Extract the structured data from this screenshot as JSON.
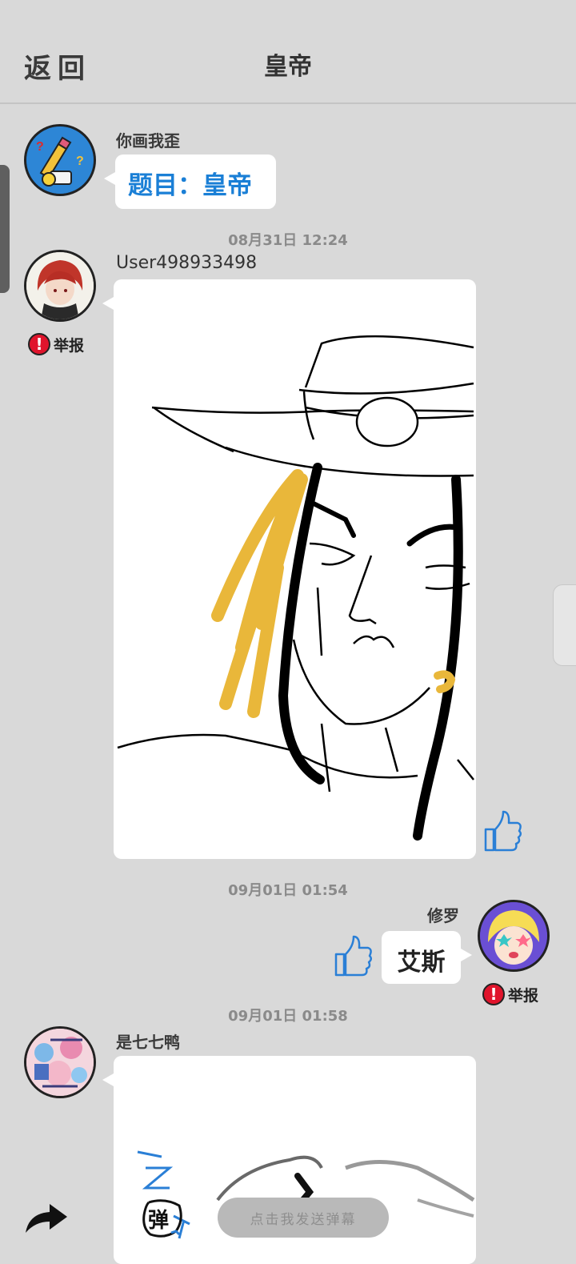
{
  "header": {
    "back_label": "返回",
    "title": "皇帝"
  },
  "messages": [
    {
      "name": "你画我歪",
      "text": "题目：皇帝"
    },
    {
      "time": "08月31日  12:24",
      "name": "User498933498",
      "report": "举报"
    },
    {
      "time": "09月01日  01:54",
      "name": "修罗",
      "text": "艾斯",
      "report": "举报"
    },
    {
      "time": "09月01日  01:58",
      "name": "是七七鸭"
    }
  ],
  "bottom": {
    "danmu_placeholder": "点击我发送弹幕",
    "danmu_icon_char": "弹"
  },
  "colors": {
    "topic_blue": "#1a7fd6",
    "report_red": "#e0142c",
    "hair_yellow": "#e9b73a",
    "like_blue": "#2a7fd6"
  },
  "icons": [
    "thumbs-up-icon",
    "share-arrow-icon",
    "danmu-icon",
    "exclamation-icon"
  ]
}
